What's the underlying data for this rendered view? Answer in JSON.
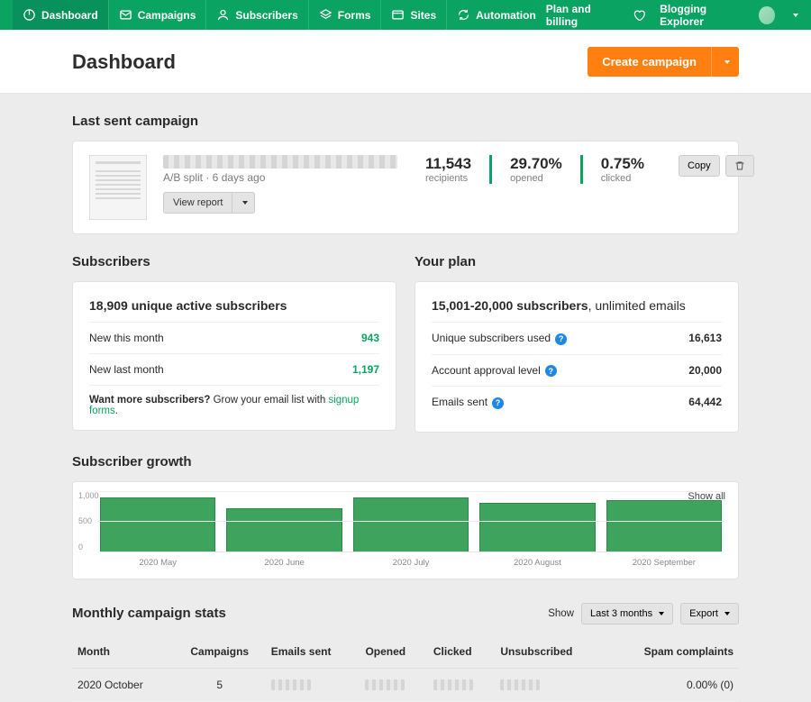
{
  "nav": {
    "items": [
      {
        "label": "Dashboard"
      },
      {
        "label": "Campaigns"
      },
      {
        "label": "Subscribers"
      },
      {
        "label": "Forms"
      },
      {
        "label": "Sites"
      },
      {
        "label": "Automation"
      }
    ],
    "plan_link": "Plan and billing",
    "user_name": "Blogging Explorer"
  },
  "header": {
    "title": "Dashboard",
    "create_label": "Create campaign"
  },
  "last_campaign": {
    "section_title": "Last sent campaign",
    "meta": "A/B split · 6 days ago",
    "view_report": "View report",
    "recipients_value": "11,543",
    "recipients_label": "recipients",
    "opened_value": "29.70%",
    "opened_label": "opened",
    "clicked_value": "0.75%",
    "clicked_label": "clicked",
    "copy_label": "Copy"
  },
  "subscribers": {
    "section_title": "Subscribers",
    "headline": "18,909 unique active subscribers",
    "rows": [
      {
        "label": "New this month",
        "value": "943"
      },
      {
        "label": "New last month",
        "value": "1,197"
      }
    ],
    "cta_bold": "Want more subscribers?",
    "cta_text": " Grow your email list with ",
    "cta_link": "signup forms",
    "cta_period": "."
  },
  "plan": {
    "section_title": "Your plan",
    "headline_range": "15,001-20,000 subscribers",
    "headline_rest": ", unlimited emails",
    "rows": [
      {
        "label": "Unique subscribers used",
        "value": "16,613"
      },
      {
        "label": "Account approval level",
        "value": "20,000"
      },
      {
        "label": "Emails sent",
        "value": "64,442"
      }
    ]
  },
  "chart_data": {
    "type": "bar",
    "title": "Subscriber growth",
    "show_all": "Show all",
    "categories": [
      "2020 May",
      "2020 June",
      "2020 July",
      "2020 August",
      "2020 September"
    ],
    "values": [
      1000,
      800,
      1000,
      900,
      950
    ],
    "ylim": [
      0,
      1000
    ],
    "yticks": [
      "1,000",
      "500",
      "0"
    ]
  },
  "monthly": {
    "title": "Monthly campaign stats",
    "show_label": "Show",
    "range_label": "Last 3 months ",
    "export_label": "Export ",
    "columns": [
      "Month",
      "Campaigns",
      "Emails sent",
      "Opened",
      "Clicked",
      "Unsubscribed",
      "Spam complaints"
    ],
    "rows": [
      {
        "month": "2020 October",
        "campaigns": "5",
        "spam": "0.00% (0)"
      }
    ]
  }
}
